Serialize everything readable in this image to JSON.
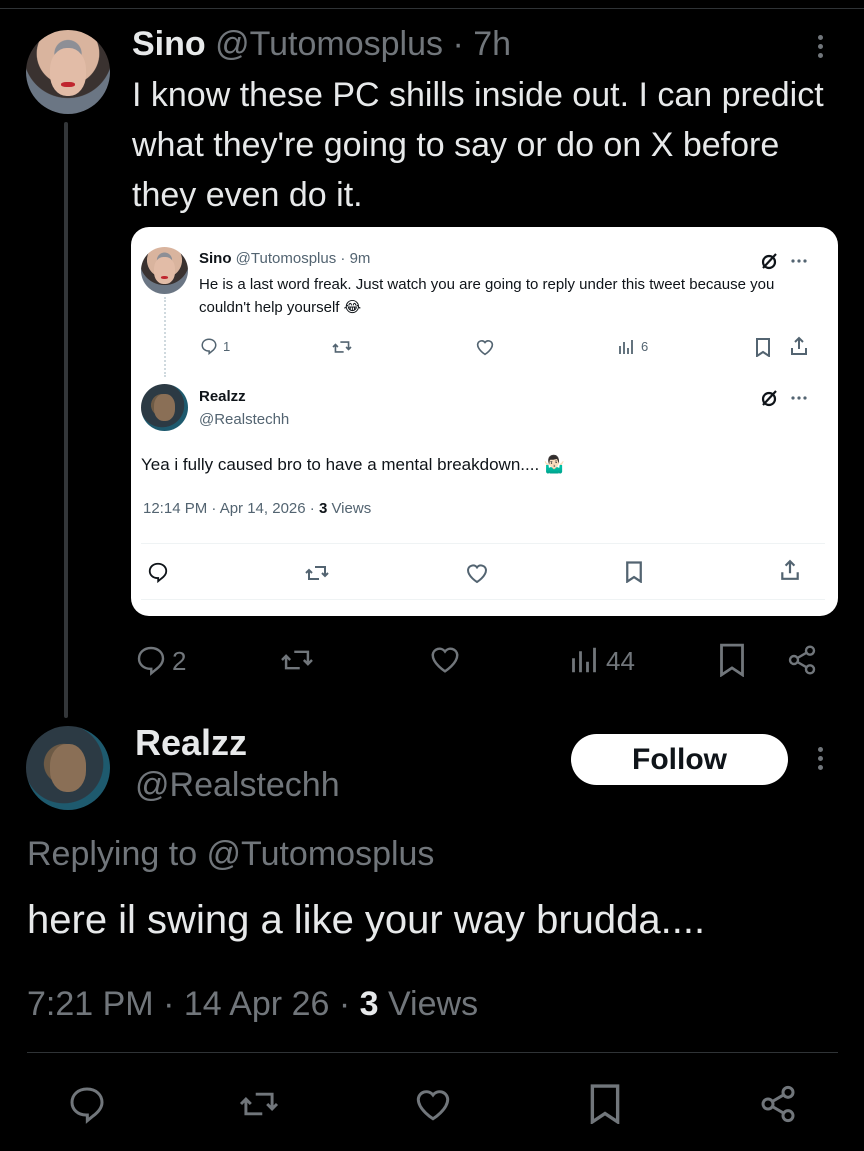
{
  "tweet": {
    "author_name": "Sino",
    "author_handle": "@Tutomosplus",
    "time": "7h",
    "text": "I know these PC shills inside out. I can predict what they're going to say or do on X before they even do it.",
    "replies": "2",
    "views": "44"
  },
  "quoted": {
    "parent": {
      "author_name": "Sino",
      "author_handle": "@Tutomosplus",
      "time": "9m",
      "text": "He is a last word freak. Just watch you are going to reply under this tweet because you couldn't help yourself 😂",
      "replies": "1",
      "views": "6"
    },
    "reply": {
      "author_name": "Realzz",
      "author_handle": "@Realstechh",
      "text": "Yea i fully caused bro to have a mental breakdown.... 🤷🏻‍♂️",
      "time": "12:14 PM · Apr 14, 2026 · ",
      "views_count": "3",
      "views_label": " Views"
    }
  },
  "reply_tweet": {
    "author_name": "Realzz",
    "author_handle": "@Realstechh",
    "follow_label": "Follow",
    "replying_prefix": "Replying to ",
    "replying_handle": "@Tutomosplus",
    "text": "here il swing a like your way brudda....",
    "time": "7:21 PM · 14 Apr 26 · ",
    "views_count": "3",
    "views_label": " Views"
  },
  "colors": {
    "background": "#000000",
    "text_primary": "#e7e9ea",
    "text_muted": "#71767b",
    "card_bg": "#ffffff",
    "divider": "#2f3336"
  },
  "icons": [
    "more-vertical-icon",
    "reply-icon",
    "retweet-icon",
    "like-icon",
    "views-icon",
    "bookmark-icon",
    "share-icon",
    "grok-icon",
    "more-horizontal-icon"
  ]
}
